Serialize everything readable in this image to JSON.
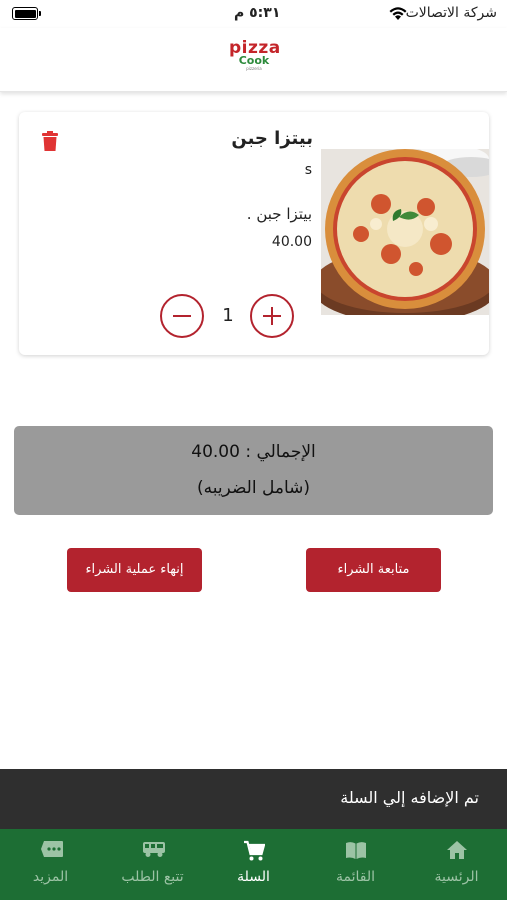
{
  "status_bar": {
    "time": "٥:٣١ م",
    "carrier": "شركة الاتصالات"
  },
  "header": {
    "logo_line1": "pizza",
    "logo_line2": "Cook",
    "logo_line3": "pizzeria"
  },
  "cart_item": {
    "name": "بيتزا جبن",
    "size": "s",
    "description": "بيتزا جبن .",
    "price": "40.00",
    "quantity": "1",
    "image_icon": "pizza-image"
  },
  "total": {
    "line": "الإجمالي : 40.00",
    "tax_note": "(شامل الضريبه)"
  },
  "buttons": {
    "finish": "إنهاء عملية الشراء",
    "continue": "متابعة الشراء"
  },
  "toast": {
    "message": "تم الإضافه إلي السلة"
  },
  "bottom_nav": {
    "items": [
      {
        "label": "الرئسية",
        "icon": "home-icon",
        "active": false
      },
      {
        "label": "القائمة",
        "icon": "book-icon",
        "active": false
      },
      {
        "label": "السلة",
        "icon": "cart-icon",
        "active": true
      },
      {
        "label": "تتبع الطلب",
        "icon": "truck-icon",
        "active": false
      },
      {
        "label": "المزيد",
        "icon": "more-icon",
        "active": false
      }
    ]
  },
  "colors": {
    "primary_red": "#b3232e",
    "nav_green": "#1d6e34",
    "total_gray": "#9a9a9a",
    "toast_dark": "#2f2f2f"
  }
}
